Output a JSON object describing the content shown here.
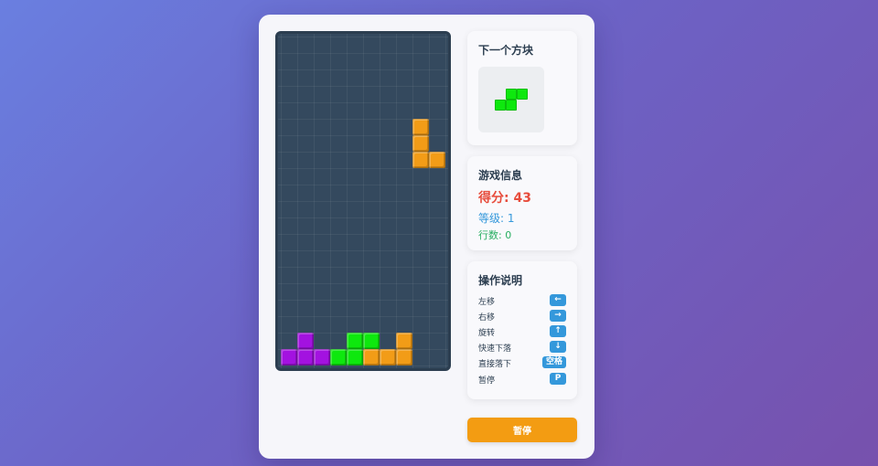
{
  "colors": {
    "purple": "#a312e0",
    "green": "#0ee80e",
    "orange": "#f29c17",
    "score": "#e74c3c",
    "level": "#3498db",
    "lines": "#27ae60",
    "button": "#f39c12",
    "key": "#3498db"
  },
  "board": {
    "cols": 10,
    "rows": 20,
    "falling_piece": {
      "color": "orange",
      "cells": [
        [
          8,
          5
        ],
        [
          8,
          6
        ],
        [
          8,
          7
        ],
        [
          9,
          7
        ]
      ]
    },
    "locked_cells": [
      {
        "col": 1,
        "row": 18,
        "color": "purple"
      },
      {
        "col": 0,
        "row": 19,
        "color": "purple"
      },
      {
        "col": 1,
        "row": 19,
        "color": "purple"
      },
      {
        "col": 2,
        "row": 19,
        "color": "purple"
      },
      {
        "col": 4,
        "row": 18,
        "color": "green"
      },
      {
        "col": 5,
        "row": 18,
        "color": "green"
      },
      {
        "col": 3,
        "row": 19,
        "color": "green"
      },
      {
        "col": 4,
        "row": 19,
        "color": "green"
      },
      {
        "col": 5,
        "row": 19,
        "color": "orange"
      },
      {
        "col": 6,
        "row": 19,
        "color": "orange"
      },
      {
        "col": 7,
        "row": 18,
        "color": "orange"
      },
      {
        "col": 7,
        "row": 19,
        "color": "orange"
      }
    ]
  },
  "next_panel": {
    "title": "下一个方块",
    "piece": {
      "color": "green",
      "cells": [
        [
          1,
          0
        ],
        [
          2,
          0
        ],
        [
          0,
          1
        ],
        [
          1,
          1
        ]
      ]
    }
  },
  "info_panel": {
    "title": "游戏信息",
    "score_text": "得分: 43",
    "level_text": "等级: 1",
    "lines_text": "行数: 0"
  },
  "controls_panel": {
    "title": "操作说明",
    "items": [
      {
        "label": "左移",
        "key": "←"
      },
      {
        "label": "右移",
        "key": "→"
      },
      {
        "label": "旋转",
        "key": "↑"
      },
      {
        "label": "快速下落",
        "key": "↓"
      },
      {
        "label": "直接落下",
        "key": "空格"
      },
      {
        "label": "暂停",
        "key": "P"
      }
    ]
  },
  "pause_button": {
    "label": "暂停"
  }
}
